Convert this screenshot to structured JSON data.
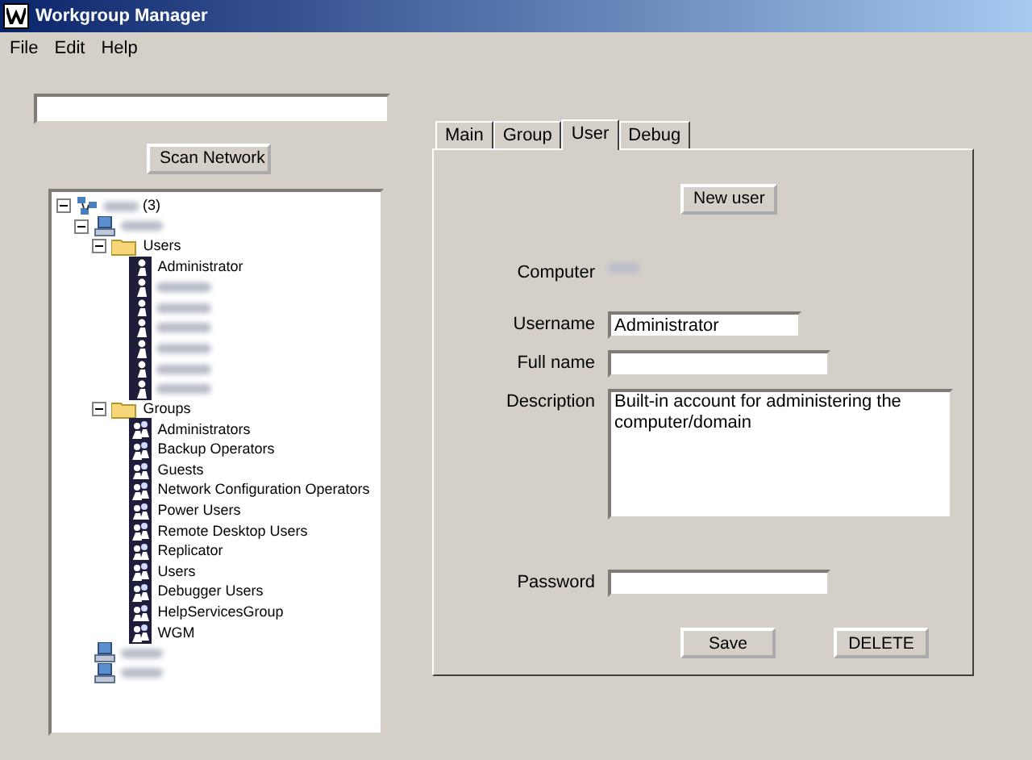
{
  "window": {
    "title": "Workgroup Manager"
  },
  "menu": [
    "File",
    "Edit",
    "Help"
  ],
  "scan_button": "Scan Network",
  "tree": [
    {
      "kind": "network",
      "blurred": true,
      "count": "(3)",
      "expanded": true,
      "children": [
        {
          "kind": "computer",
          "blurred": true,
          "expanded": true,
          "children": [
            {
              "kind": "folder",
              "label": "Users",
              "expanded": true,
              "children": [
                {
                  "kind": "user",
                  "label": "Administrator"
                },
                {
                  "kind": "user",
                  "blurred": true
                },
                {
                  "kind": "user",
                  "blurred": true
                },
                {
                  "kind": "user",
                  "blurred": true
                },
                {
                  "kind": "user",
                  "blurred": true
                },
                {
                  "kind": "user",
                  "blurred": true
                },
                {
                  "kind": "user",
                  "blurred": true
                }
              ]
            },
            {
              "kind": "folder",
              "label": "Groups",
              "expanded": true,
              "children": [
                {
                  "kind": "group",
                  "label": "Administrators"
                },
                {
                  "kind": "group",
                  "label": "Backup Operators"
                },
                {
                  "kind": "group",
                  "label": "Guests"
                },
                {
                  "kind": "group",
                  "label": "Network Configuration Operators"
                },
                {
                  "kind": "group",
                  "label": "Power Users"
                },
                {
                  "kind": "group",
                  "label": "Remote Desktop Users"
                },
                {
                  "kind": "group",
                  "label": "Replicator"
                },
                {
                  "kind": "group",
                  "label": "Users"
                },
                {
                  "kind": "group",
                  "label": "Debugger Users"
                },
                {
                  "kind": "group",
                  "label": "HelpServicesGroup"
                },
                {
                  "kind": "group",
                  "label": "WGM"
                }
              ]
            }
          ]
        },
        {
          "kind": "computer",
          "blurred": true
        },
        {
          "kind": "computer",
          "blurred": true
        }
      ]
    }
  ],
  "tabs": [
    {
      "label": "Main",
      "selected": false
    },
    {
      "label": "Group",
      "selected": false
    },
    {
      "label": "User",
      "selected": true
    },
    {
      "label": "Debug",
      "selected": false
    }
  ],
  "new_user_button": "New user",
  "fields": [
    {
      "kind": "readonly",
      "label": "Computer",
      "blurred": true
    },
    {
      "kind": "text",
      "label": "Username",
      "value": "Administrator"
    },
    {
      "kind": "text",
      "label": "Full name"
    },
    {
      "kind": "textarea",
      "label": "Description",
      "value": "Built-in account for administering the computer/domain"
    },
    {
      "kind": "password",
      "label": "Password"
    }
  ],
  "buttons": [
    "Save",
    "DELETE"
  ]
}
